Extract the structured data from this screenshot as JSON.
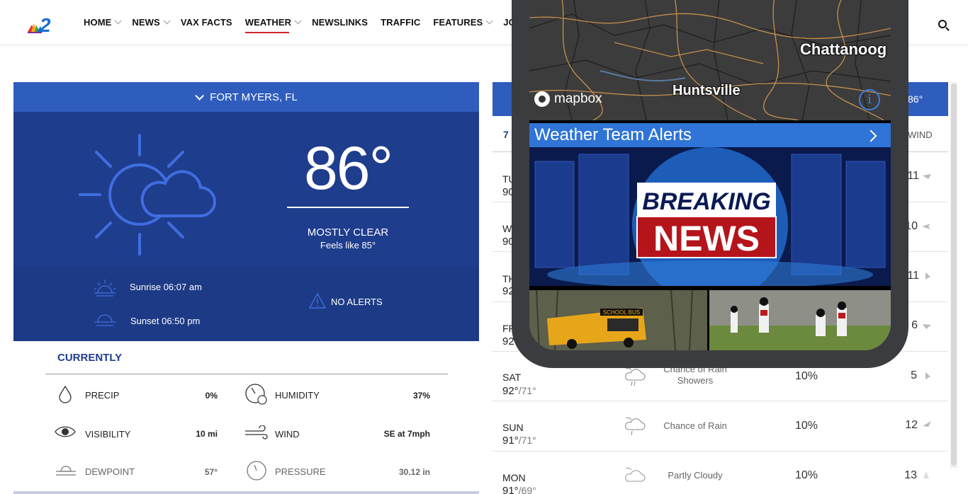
{
  "nav": {
    "items": [
      {
        "label": "HOME",
        "chevron": true
      },
      {
        "label": "NEWS",
        "chevron": true
      },
      {
        "label": "VAX FACTS",
        "chevron": false
      },
      {
        "label": "WEATHER",
        "chevron": true,
        "active": true
      },
      {
        "label": "NEWSLINKS",
        "chevron": false
      },
      {
        "label": "TRAFFIC",
        "chevron": false
      },
      {
        "label": "FEATURES",
        "chevron": true
      },
      {
        "label": "JOBS",
        "chevron": false
      }
    ],
    "logo_colors": [
      "#e8312e",
      "#f7a823",
      "#41a72d",
      "#1a6fd0",
      "#7d2d97"
    ],
    "active_color": "#d5232a"
  },
  "current": {
    "location": "FORT MYERS, FL",
    "temperature": "86°",
    "condition": "MOSTLY CLEAR",
    "feels_like": "Feels like 85°",
    "sunrise": "Sunrise 06:07 am",
    "sunset": "Sunset 06:50 pm",
    "alerts": "NO ALERTS",
    "section_title": "CURRENTLY",
    "stats": [
      {
        "label": "PRECIP",
        "value": "0%",
        "icon": "raindrop-icon"
      },
      {
        "label": "HUMIDITY",
        "value": "37%",
        "icon": "humidity-gauge-icon"
      },
      {
        "label": "VISIBILITY",
        "value": "10 mi",
        "icon": "eye-icon"
      },
      {
        "label": "WIND",
        "value": "SE at 7mph",
        "icon": "wind-icon"
      },
      {
        "label": "DEWPOINT",
        "value": "57°",
        "icon": "dewpoint-icon"
      },
      {
        "label": "PRESSURE",
        "value": "30.12 in",
        "icon": "pressure-gauge-icon"
      }
    ]
  },
  "forecast": {
    "header_left": "7",
    "header_wind": "WIND",
    "bar_temp": "86°",
    "rows": [
      {
        "day": "TU",
        "hi": "90",
        "lo": "",
        "desc": "",
        "pct": "",
        "wind": "11"
      },
      {
        "day": "W",
        "hi": "90",
        "lo": "",
        "desc": "",
        "pct": "",
        "wind": "10"
      },
      {
        "day": "TH",
        "hi": "92",
        "lo": "",
        "desc": "",
        "pct": "",
        "wind": "11"
      },
      {
        "day": "FRI",
        "hi": "92°",
        "lo": "/",
        "desc": "",
        "pct": "",
        "wind": "6"
      },
      {
        "day": "SAT",
        "hi": "92°",
        "lo": "/71°",
        "desc": "Chance of Rain Showers",
        "pct": "10%",
        "wind": "5"
      },
      {
        "day": "SUN",
        "hi": "91°",
        "lo": "/71°",
        "desc": "Chance of Rain",
        "pct": "10%",
        "wind": "12"
      },
      {
        "day": "MON",
        "hi": "91°",
        "lo": "/69°",
        "desc": "Partly Cloudy",
        "pct": "10%",
        "wind": "13"
      }
    ]
  },
  "phone": {
    "map_cities": [
      "Chattanoog",
      "Huntsville"
    ],
    "mapbox_label": "mapbox",
    "info_label": "i",
    "alerts_title": "Weather Team Alerts",
    "breaking_line1": "BREAKING",
    "breaking_line2": "NEWS",
    "bus_sign": "SCHOOL BUS"
  }
}
